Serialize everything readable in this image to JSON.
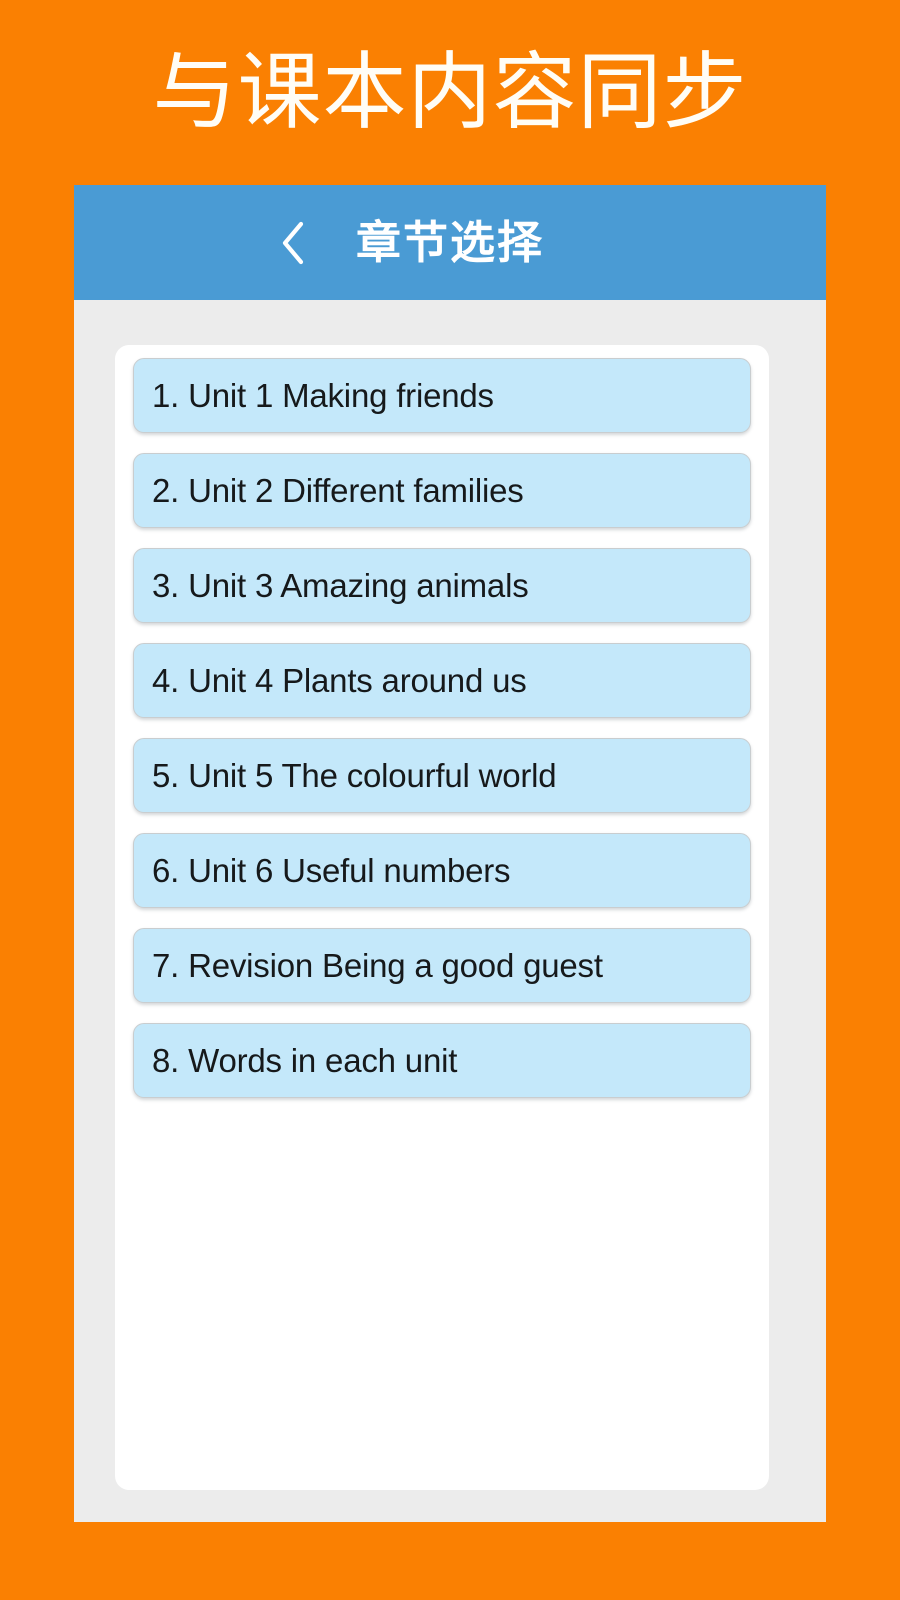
{
  "promo": {
    "headline": "与课本内容同步",
    "background_color": "#FA8002",
    "text_color": "#FFFDF6"
  },
  "app": {
    "top_bar": {
      "back_icon": "chevron-left-icon",
      "title": "章节选择",
      "background_color": "#4A9BD4",
      "title_color": "#FFFFFF"
    },
    "card": {
      "background_color": "#FFFFFF"
    },
    "chapter_list": {
      "item_background_color": "#C4E8FA",
      "item_border_color": "#C9CDCF",
      "item_text_color": "#16191B",
      "items": [
        {
          "label": "1. Unit 1 Making friends"
        },
        {
          "label": "2. Unit 2 Different families"
        },
        {
          "label": "3. Unit 3 Amazing animals"
        },
        {
          "label": "4. Unit 4 Plants around us"
        },
        {
          "label": "5. Unit 5 The colourful world"
        },
        {
          "label": "6. Unit 6 Useful numbers"
        },
        {
          "label": "7. Revision Being a good guest"
        },
        {
          "label": "8. Words in each unit"
        }
      ]
    },
    "frame_background_color": "#ECECEC"
  }
}
